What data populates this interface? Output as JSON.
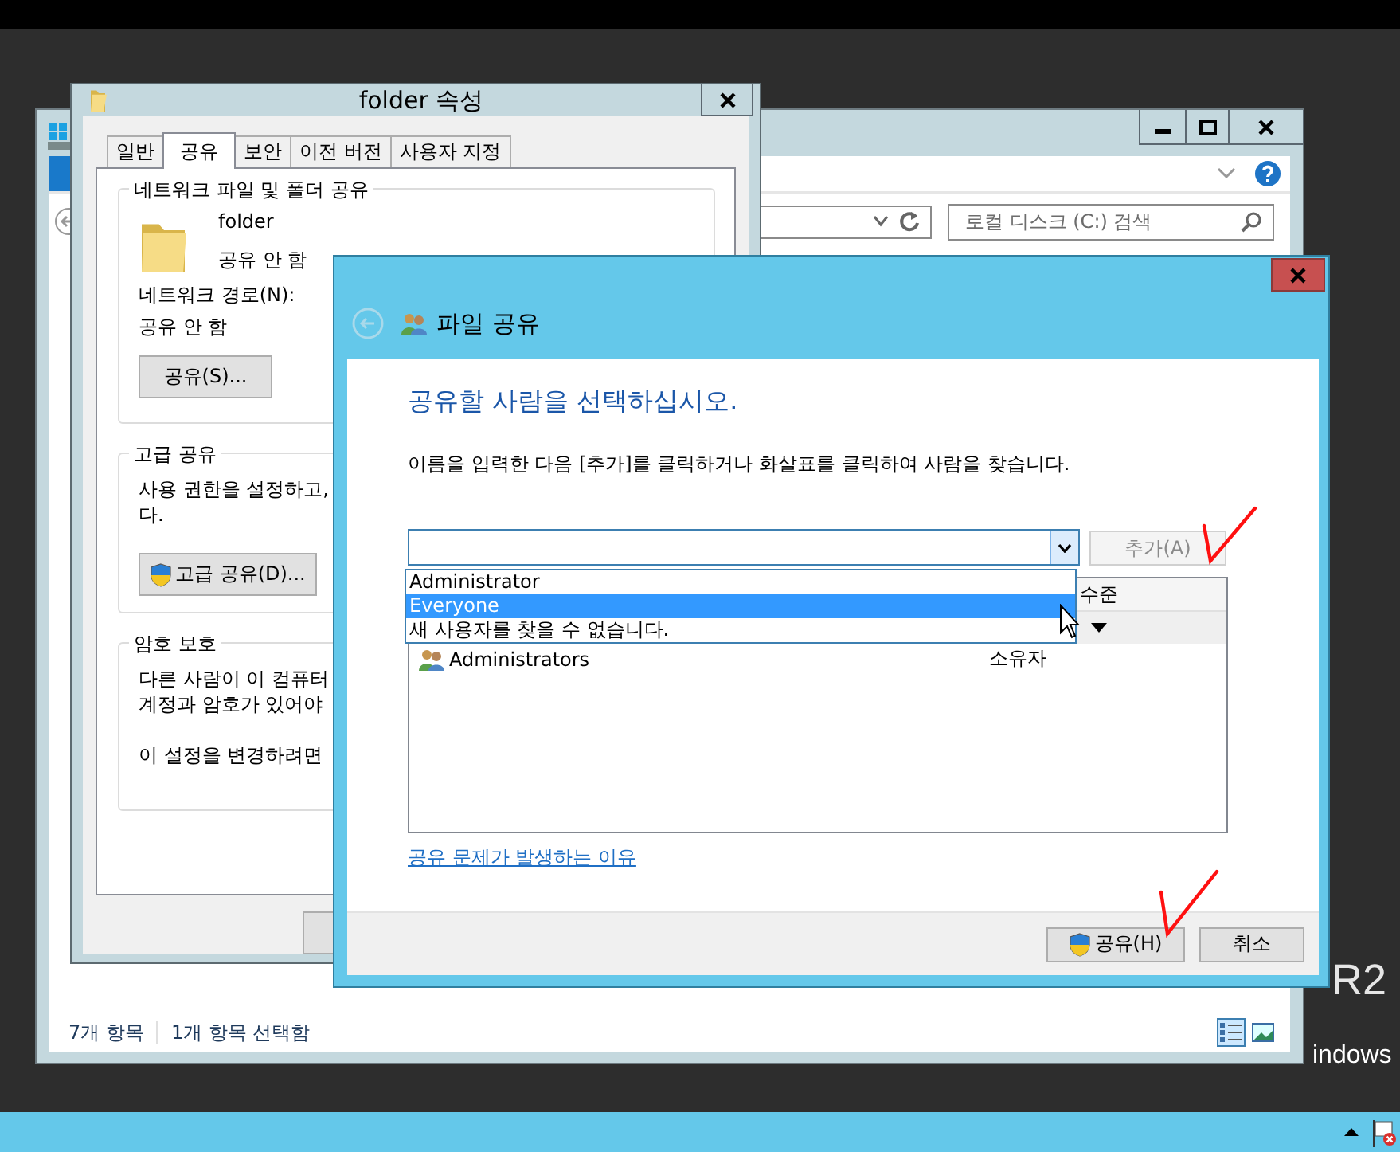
{
  "desktop": {
    "texts": [
      "R2",
      "indows"
    ]
  },
  "explorer": {
    "search": {
      "placeholder": "로컬 디스크 (C:) 검색"
    },
    "status_bar": [
      "7개 항목",
      "1개 항목 선택함"
    ],
    "views": [
      {
        "selected": true
      },
      {
        "selected": false
      }
    ]
  },
  "properties": {
    "title": "folder 속성",
    "tabs": [
      {
        "label": "일반",
        "selected": false
      },
      {
        "label": "공유",
        "selected": true
      },
      {
        "label": "보안",
        "selected": false
      },
      {
        "label": "이전 버전",
        "selected": false
      },
      {
        "label": "사용자 지정",
        "selected": false
      }
    ],
    "network_group": {
      "title": "네트워크 파일 및 폴더 공유",
      "name": "folder",
      "status": "공유 안 함",
      "path_label": "네트워크 경로(N):",
      "path": "공유 안 함",
      "button": "공유(S)..."
    },
    "advanced_group": {
      "title": "고급 공유",
      "text_lines": [
        "사용 권한을 설정하고,",
        "다."
      ],
      "button": "고급 공유(D)..."
    },
    "password_group": {
      "title": "암호 보호",
      "text_lines": [
        "다른 사람이 이 컴퓨터",
        "계정과 암호가 있어야"
      ],
      "change_text": "이 설정을 변경하려면"
    }
  },
  "share_dialog": {
    "title": "파일 공유",
    "heading": "공유할 사람을 선택하십시오.",
    "instruction": "이름을 입력한 다음 [추가]를 클릭하거나 화살표를 클릭하여 사람을 찾습니다.",
    "add_button": {
      "label": "추가(A)",
      "disabled": true
    },
    "dropdown": [
      {
        "label": "Administrator",
        "selected": false
      },
      {
        "label": "Everyone",
        "selected": true
      },
      {
        "label": "새 사용자를 찾을 수 없습니다.",
        "selected": false
      }
    ],
    "list": {
      "column_2": "수준",
      "rows": [
        {
          "name": "Administrators",
          "permission": "소유자"
        }
      ]
    },
    "link": "공유 문제가 발생하는 이유",
    "buttons": [
      {
        "label": "공유(H)",
        "shield": true
      },
      {
        "label": "취소",
        "shield": false
      }
    ]
  }
}
